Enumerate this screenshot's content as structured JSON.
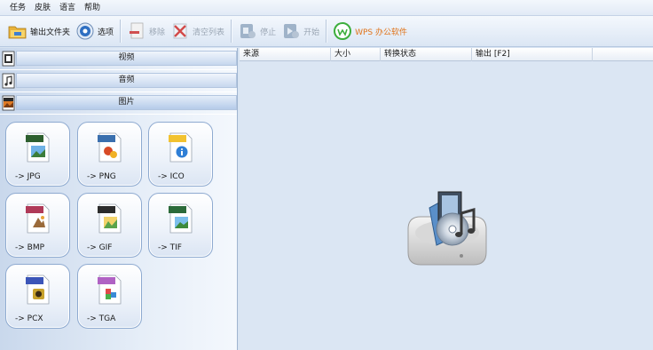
{
  "menu": [
    "任务",
    "皮肤",
    "语言",
    "帮助"
  ],
  "toolbar": {
    "output_folder": "输出文件夹",
    "options": "选项",
    "remove": "移除",
    "clear_list": "清空列表",
    "stop": "停止",
    "start": "开始",
    "wps": "WPS 办公软件"
  },
  "categories": [
    {
      "label": "视频",
      "icon": "video-icon"
    },
    {
      "label": "音频",
      "icon": "audio-icon"
    },
    {
      "label": "图片",
      "icon": "picture-icon"
    }
  ],
  "formats": [
    {
      "tag": "JPG",
      "label": "-> JPG",
      "color": "#2d5f2f"
    },
    {
      "tag": "PNG",
      "label": "-> PNG",
      "color": "#3a6fae"
    },
    {
      "tag": "ICO",
      "label": "-> ICO",
      "color": "#f2c230"
    },
    {
      "tag": "BMP",
      "label": "-> BMP",
      "color": "#b03a58"
    },
    {
      "tag": "GIF",
      "label": "-> GIF",
      "color": "#2c2c2c"
    },
    {
      "tag": "TIFF",
      "label": "-> TIF",
      "color": "#2b6a3a"
    },
    {
      "tag": "PCX",
      "label": "-> PCX",
      "color": "#3b55b8"
    },
    {
      "tag": "TGA",
      "label": "-> TGA",
      "color": "#b062c4"
    }
  ],
  "table": {
    "columns": [
      "来源",
      "大小",
      "转换状态",
      "输出 [F2]"
    ]
  },
  "colors": {
    "wps_text": "#e0741a",
    "disabled_text": "#9aa6b4",
    "panel_bg": "#dbe6f3"
  }
}
